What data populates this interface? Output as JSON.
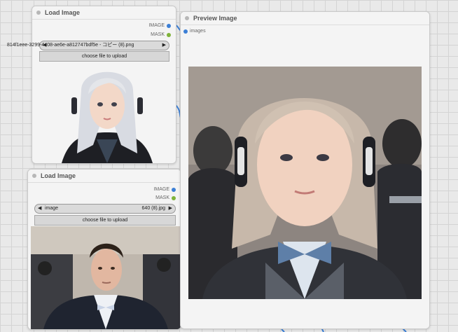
{
  "colors": {
    "image_socket": "#3c7fd6",
    "mask_socket": "#7fb33a",
    "link": "#3c7fd6"
  },
  "load_image_1": {
    "title": "Load Image",
    "outputs": {
      "image": "IMAGE",
      "mask": "MASK"
    },
    "file_value": "814f1eee-3299-4408-ae6e-a812747bdf5e - コピー (8).png",
    "upload_button": "choose file to upload",
    "preview": "white-haired-woman-headphones-portrait"
  },
  "load_image_2": {
    "title": "Load Image",
    "outputs": {
      "image": "IMAGE",
      "mask": "MASK"
    },
    "file_label": "image",
    "file_value": "640 (8).jpg",
    "upload_button": "choose file to upload",
    "preview": "man-in-tuxedo-portrait"
  },
  "preview_node": {
    "title": "Preview Image",
    "input_label": "images",
    "preview": "woman-headphones-tuxedo-portrait"
  },
  "icons": {
    "left_arrow": "◀",
    "right_arrow": "▶"
  }
}
